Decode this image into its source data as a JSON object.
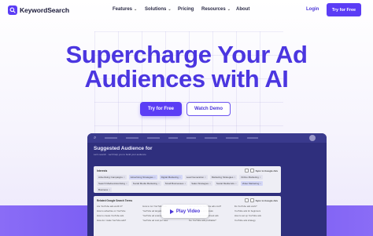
{
  "brand": {
    "name": "KeywordSearch",
    "accent": "#5b3df5"
  },
  "nav": {
    "links": [
      {
        "label": "Features",
        "has_menu": true
      },
      {
        "label": "Solutions",
        "has_menu": true
      },
      {
        "label": "Pricing",
        "has_menu": false
      },
      {
        "label": "Resources",
        "has_menu": true
      },
      {
        "label": "About",
        "has_menu": false
      }
    ],
    "login": "Login",
    "cta": "Try for Free"
  },
  "hero": {
    "line1": "Supercharge Your Ad",
    "line2": "Audiences with AI",
    "primary_cta": "Try for Free",
    "secondary_cta": "Watch Demo"
  },
  "app": {
    "heading": "Suggested Audience for",
    "subheading": "Let's search · we'll help you to build your audience",
    "card1": {
      "title": "Interests",
      "action": "Sync to Google Ads",
      "chips": [
        {
          "label": "Advertising Campaigns",
          "selected": false
        },
        {
          "label": "Advertising Strategies",
          "selected": true
        },
        {
          "label": "Digital Marketing",
          "selected": true
        },
        {
          "label": "Lead Generation",
          "selected": false
        },
        {
          "label": "Marketing Strategies",
          "selected": false
        },
        {
          "label": "Online Marketing",
          "selected": false
        },
        {
          "label": "Search Media Advertising",
          "selected": false
        },
        {
          "label": "Social Media Marketing",
          "selected": false
        },
        {
          "label": "Small Businesses",
          "selected": false
        },
        {
          "label": "Sales Strategies",
          "selected": false
        },
        {
          "label": "Social Media Ads",
          "selected": false
        },
        {
          "label": "Video Marketing",
          "selected": true
        },
        {
          "label": "Business",
          "selected": false
        }
      ]
    },
    "card2": {
      "title": "Related Google Search Terms",
      "action": "Sync to Google Ads",
      "terms": [
        "Are YouTube ads worth it?",
        "How to run YouTube ads",
        "How much do YouTube ads cost?",
        "Do YouTube ads work?",
        "How to advertise on YouTube",
        "YouTube ad targeting",
        "Best YouTube ad formats",
        "YouTube ads for beginners",
        "How to create YouTube ads",
        "YouTube ad examples",
        "YouTube ads vs Facebook ads",
        "How to set up YouTube ads",
        "How do I make YouTube ads?",
        "YouTube ad cost per view",
        "Are YouTube ads profitable?",
        "YouTube ads strategy"
      ]
    },
    "play_label": "Play Video"
  }
}
